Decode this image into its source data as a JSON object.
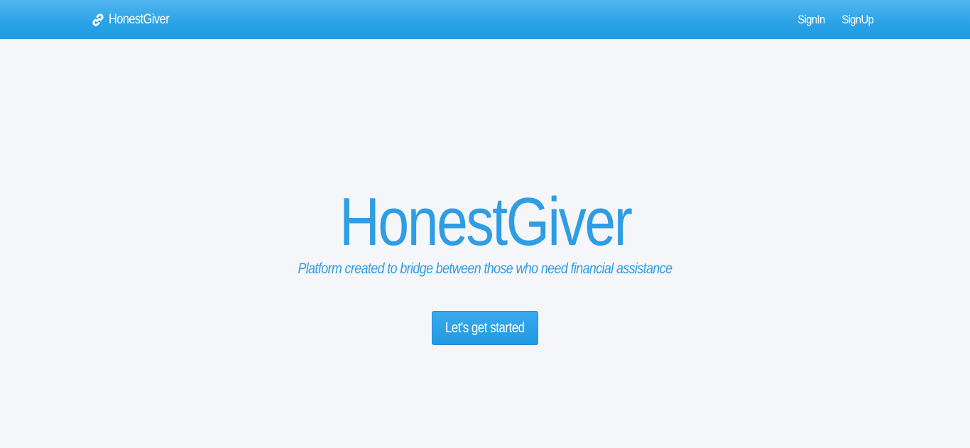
{
  "navbar": {
    "brand": {
      "icon": "link-icon",
      "label": "HonestGiver"
    },
    "links": [
      {
        "label": "SignIn"
      },
      {
        "label": "SignUp"
      }
    ],
    "color": "#29a2e7"
  },
  "hero": {
    "title": "HonestGiver",
    "subtitle": "Platform created to bridge between those who need financial assistance",
    "cta_label": "Let's get started",
    "accent_color": "#2f9de3"
  },
  "page": {
    "background": "#f4f6fa"
  }
}
